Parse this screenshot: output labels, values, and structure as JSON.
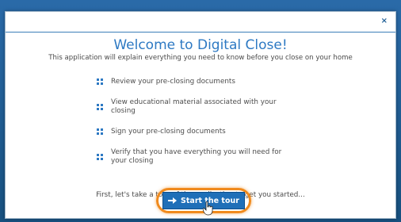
{
  "dialog": {
    "close_label": "×",
    "title": "Welcome to Digital Close!",
    "subtitle": "This application will explain everything you need to know before you close on your home",
    "items": [
      "Review your pre-closing documents",
      "View educational material associated with your closing",
      "Sign your pre-closing documents",
      "Verify that you have everything you will need for your closing"
    ],
    "intro": "First, let's take a tour of the application to get you started...",
    "start_button": "Start the tour"
  },
  "colors": {
    "accent": "#2d79c3",
    "button": "#1f6fb8",
    "highlight": "#f08a1d"
  },
  "icons": [
    "close-icon",
    "bullet-dots-icon",
    "arrow-right-icon",
    "hand-cursor-icon"
  ]
}
